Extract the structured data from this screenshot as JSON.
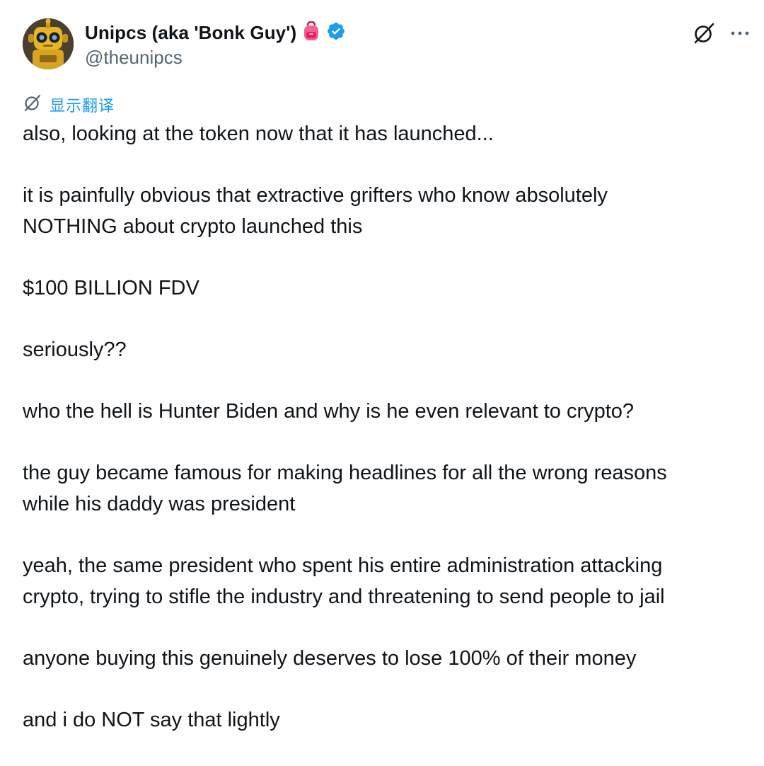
{
  "author": {
    "display_name": "Unipcs (aka 'Bonk Guy')",
    "emoji_badge": "pink-backpack-emoji",
    "verified_icon": "verified-badge-icon",
    "handle": "@theunipcs",
    "avatar_icon": "robot-avatar"
  },
  "actions": {
    "grok_icon": "grok-icon",
    "more_icon": "more-options-icon"
  },
  "translate": {
    "icon": "translate-icon",
    "label": "显示翻译"
  },
  "tweet": {
    "paragraphs": [
      [
        "also, looking at the token now that it has launched..."
      ],
      [
        "it is painfully obvious that extractive grifters who know absolutely",
        "NOTHING about crypto launched this"
      ],
      [
        "$100 BILLION FDV"
      ],
      [
        "seriously??"
      ],
      [
        "who the hell is Hunter Biden and why is he even relevant to crypto?"
      ],
      [
        "the guy became famous for making headlines for all the wrong reasons",
        "while his daddy was president"
      ],
      [
        "yeah, the same president who spent his entire administration attacking",
        "crypto, trying to stifle the industry and threatening to send people to jail"
      ],
      [
        "anyone buying this genuinely deserves to lose 100% of their money"
      ],
      [
        "and i do NOT say that lightly"
      ]
    ]
  },
  "colors": {
    "text": "#0f1419",
    "secondary": "#536471",
    "link": "#1d9bf0",
    "verified": "#1d9bf0"
  }
}
